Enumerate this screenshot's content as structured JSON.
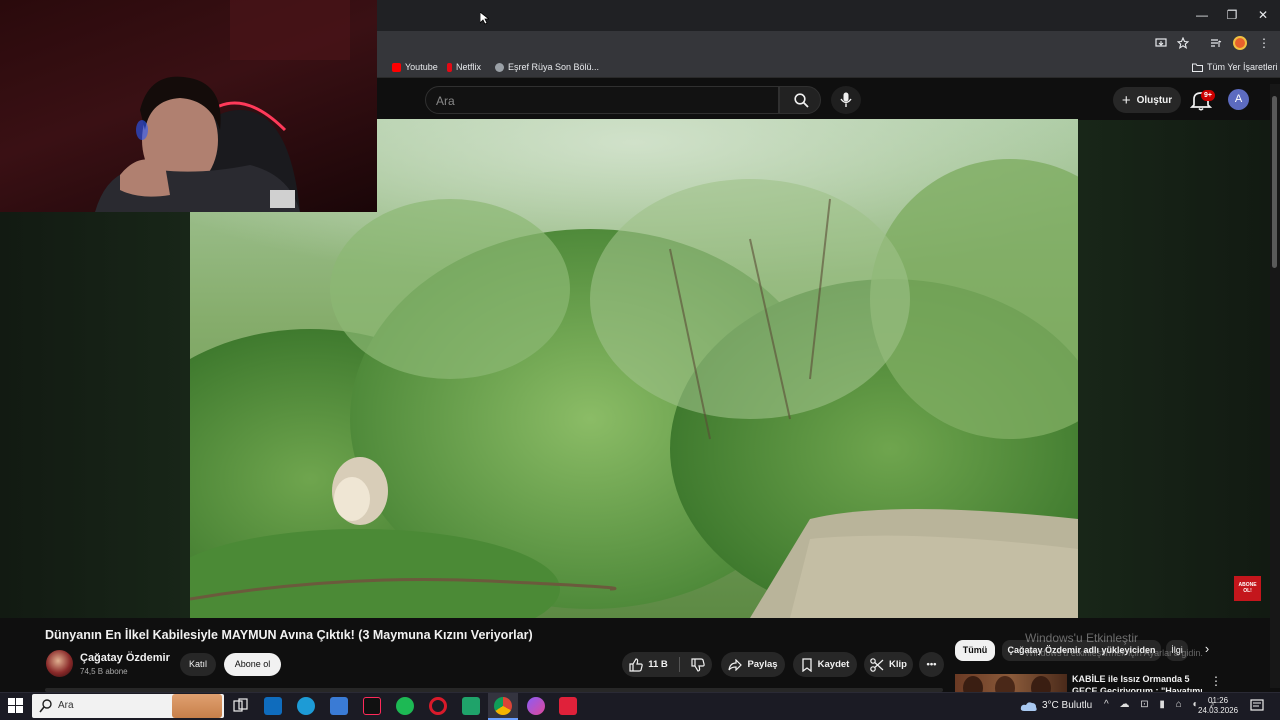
{
  "browser": {
    "window_controls": {
      "minimize": "—",
      "maximize": "❐",
      "close": "✕"
    },
    "bookmarks": [
      {
        "label": "Youtube",
        "color": "#ff0000"
      },
      {
        "label": "Netflix",
        "color": "#e50914"
      },
      {
        "label": "Eşref Rüya Son Bölü...",
        "color": "#9aa0a6"
      }
    ],
    "all_bookmarks_label": "Tüm Yer İşaretleri"
  },
  "youtube": {
    "search_placeholder": "Ara",
    "create_label": "Oluştur",
    "notification_count": "9+",
    "account_initial": "A",
    "abone_badge": "ABONE OL!"
  },
  "video": {
    "title": "Dünyanın En İlkel Kabilesiyle MAYMUN Avına Çıktık! (3 Maymuna Kızını Veriyorlar)",
    "channel_name": "Çağatay Özdemir",
    "subscriber_count": "74,5 B abone",
    "join_label": "Katıl",
    "subscribe_label": "Abone ol",
    "like_count": "11 B",
    "share_label": "Paylaş",
    "save_label": "Kaydet",
    "clip_label": "Klip",
    "more_label": "•••"
  },
  "sidebar": {
    "chips": [
      {
        "label": "Tümü",
        "selected": true
      },
      {
        "label": "Çağatay Özdemir adlı yükleyiciden",
        "selected": false
      },
      {
        "label": "İlgi",
        "selected": false
      }
    ],
    "recommendation": {
      "title_line1": "KABİLE ile Issız Ormanda 5",
      "title_line2": "GECE Geçiriyorum : \"Hayatımı"
    },
    "windows_watermark_line1": "Windows'u Etkinleştir",
    "windows_watermark_line2": "Windows'u etkinleştirmek için Ayarlar'a gidin."
  },
  "taskbar": {
    "search_placeholder": "Ara",
    "pinned_apps": [
      {
        "name": "task-view",
        "color": "#3a3a46"
      },
      {
        "name": "outlook",
        "color": "#0f6cbd"
      },
      {
        "name": "edge",
        "color": "#1d9bd6"
      },
      {
        "name": "store",
        "color": "#3a7bd5"
      },
      {
        "name": "tiktok",
        "color": "#111111"
      },
      {
        "name": "spotify",
        "color": "#1db954"
      },
      {
        "name": "opera",
        "color": "#d91a2a"
      },
      {
        "name": "app-green",
        "color": "#1fa36a"
      },
      {
        "name": "chrome",
        "color": "#e2b72b"
      },
      {
        "name": "messenger",
        "color": "#8a5cf6"
      },
      {
        "name": "app-red",
        "color": "#e0213a"
      }
    ],
    "weather": "3°C  Bulutlu",
    "time": "01:26",
    "date": "24.03.2026"
  }
}
